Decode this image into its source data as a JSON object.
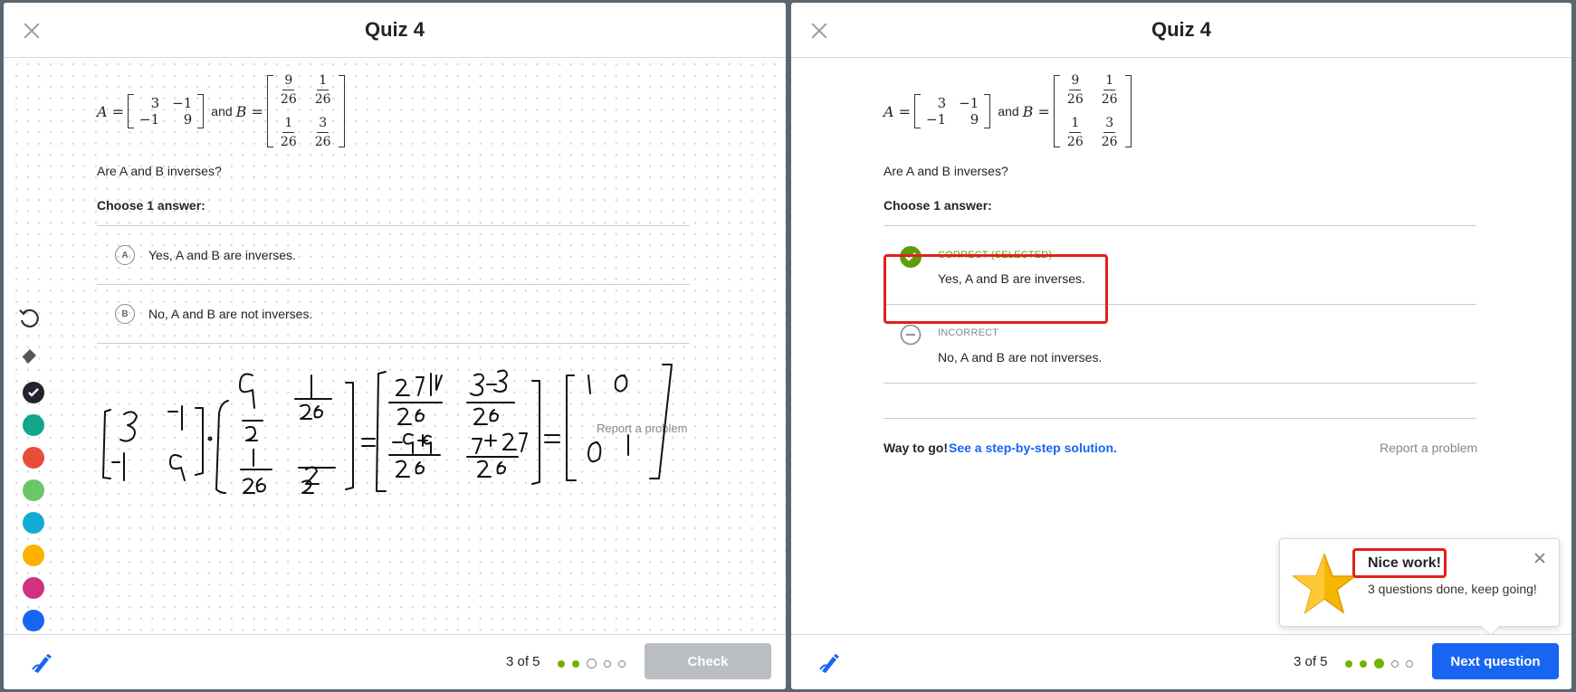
{
  "left_panel": {
    "title": "Quiz 4",
    "matrix_a_label": "A =",
    "matrix_a": [
      "3",
      "−1",
      "−1",
      "9"
    ],
    "and_text": "and",
    "matrix_b_label": "B =",
    "matrix_b": [
      {
        "num": "9",
        "den": "26"
      },
      {
        "num": "1",
        "den": "26"
      },
      {
        "num": "1",
        "den": "26"
      },
      {
        "num": "3",
        "den": "26"
      }
    ],
    "question": "Are A and B inverses?",
    "choose_label": "Choose 1 answer:",
    "choices": [
      {
        "letter": "A",
        "text": "Yes, A and B are inverses."
      },
      {
        "letter": "B",
        "text": "No, A and B are not inverses."
      }
    ],
    "report_link": "Report a problem",
    "progress_text": "3 of 5",
    "check_button": "Check",
    "colors": {
      "green": "#71b307",
      "teal": "#14a58b",
      "red": "#e84d39",
      "light_green": "#6cc566",
      "cyan": "#11acd3",
      "yellow": "#ffb100",
      "magenta": "#d0327f",
      "blue": "#1865f2"
    }
  },
  "right_panel": {
    "title": "Quiz 4",
    "matrix_a_label": "A =",
    "matrix_a": [
      "3",
      "−1",
      "−1",
      "9"
    ],
    "and_text": "and",
    "matrix_b_label": "B =",
    "matrix_b": [
      {
        "num": "9",
        "den": "26"
      },
      {
        "num": "1",
        "den": "26"
      },
      {
        "num": "1",
        "den": "26"
      },
      {
        "num": "3",
        "den": "26"
      }
    ],
    "question": "Are A and B inverses?",
    "choose_label": "Choose 1 answer:",
    "correct_choice": {
      "status": "CORRECT (SELECTED)",
      "text": "Yes, A and B are inverses."
    },
    "incorrect_choice": {
      "status": "INCORRECT",
      "text": "No, A and B are not inverses."
    },
    "way_to_go": "Way to go!",
    "solution_link": "See a step-by-step solution.",
    "report_link": "Report a problem",
    "progress_text": "3 of 5",
    "next_button": "Next question",
    "toast": {
      "title": "Nice work!",
      "body": "3 questions done, keep going!"
    }
  }
}
